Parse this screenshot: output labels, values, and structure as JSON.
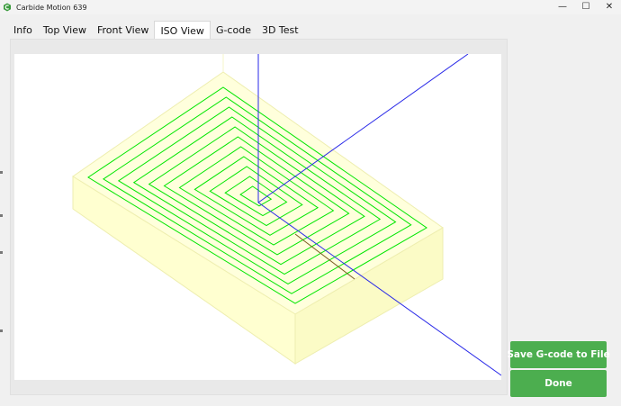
{
  "window": {
    "title": "Carbide Motion 639",
    "minimize_glyph": "—",
    "maximize_glyph": "☐",
    "close_glyph": "✕"
  },
  "tabs": [
    {
      "label": "Info"
    },
    {
      "label": "Top View"
    },
    {
      "label": "Front View"
    },
    {
      "label": "ISO View",
      "active": true
    },
    {
      "label": "G-code"
    },
    {
      "label": "3D Test"
    }
  ],
  "buttons": {
    "save_label": "Save G-code to File",
    "done_label": "Done"
  },
  "colors": {
    "accent_green": "#4cae4f",
    "toolpath": "#00e600",
    "axis": "#2020e0",
    "stock_fill": "#ffffd9"
  },
  "icons": {
    "app": "carbide-logo-icon",
    "minimize": "minimize-icon",
    "maximize": "maximize-icon",
    "close": "close-icon"
  }
}
